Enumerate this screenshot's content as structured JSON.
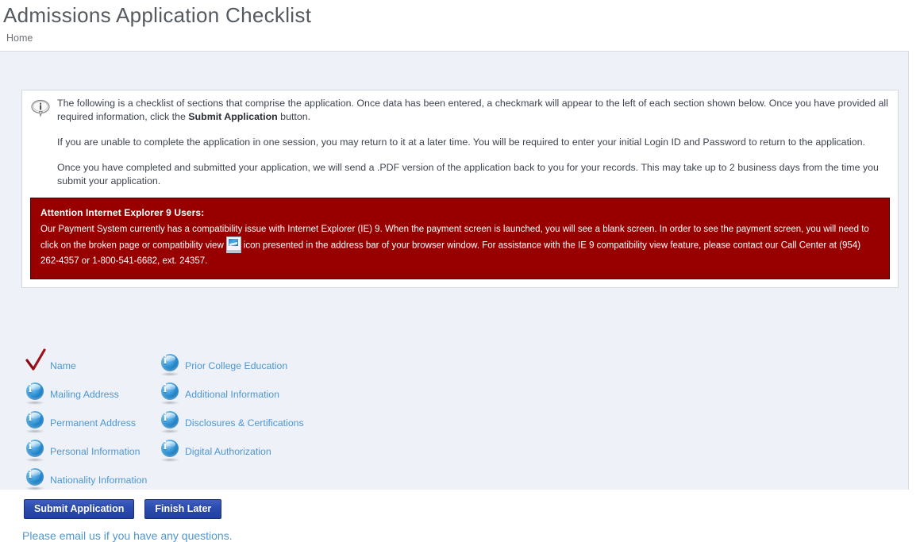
{
  "header": {
    "title": "Admissions Application Checklist",
    "breadcrumb": "Home"
  },
  "info_panel": {
    "icon": "info-bubble-icon",
    "paragraphs": [
      {
        "pre": "The following is a checklist of sections that comprise the application. Once data has been entered, a checkmark will appear to the left of each section shown below. Once you have provided all required information, click the ",
        "bold": "Submit Application",
        "post": " button."
      },
      {
        "pre": "If you are unable to complete the application in one session, you may return to it at a later time. You will be required to enter your initial Login ID and Password to return to the application.",
        "bold": "",
        "post": ""
      },
      {
        "pre": "Once you have completed and submitted your application, we will send a .PDF version of the application back to you for your records. This may take up to 2 business days from the time you submit your application.",
        "bold": "",
        "post": ""
      }
    ]
  },
  "ie_alert": {
    "title": "Attention Internet Explorer 9 Users:",
    "body_part1": "Our Payment System currently has a compatibility issue with Internet Explorer (IE) 9. When the payment screen is launched, you will see a blank screen. In order to see the payment screen, you will need to click on the broken page or compatibility view",
    "icon": "compatibility-view-icon",
    "body_part2": "icon presented in the address bar of your browser window. For assistance with the IE 9 compatibility view feature, please contact our Call Center at (954) 262-4357 or 1-800-541-6682, ext. 24357.",
    "background_color": "#980000",
    "text_color": "#ffffff"
  },
  "checklist": {
    "left_column": [
      {
        "label": "Name",
        "status": "complete",
        "icon": "red-checkmark-icon"
      },
      {
        "label": "Mailing Address",
        "status": "incomplete",
        "icon": "blue-info-ball-icon"
      },
      {
        "label": "Permanent Address",
        "status": "incomplete",
        "icon": "blue-info-ball-icon"
      },
      {
        "label": "Personal Information",
        "status": "incomplete",
        "icon": "blue-info-ball-icon"
      },
      {
        "label": "Nationality Information",
        "status": "incomplete",
        "icon": "blue-info-ball-icon"
      }
    ],
    "right_column": [
      {
        "label": "Prior College Education",
        "status": "incomplete",
        "icon": "blue-info-ball-icon"
      },
      {
        "label": "Additional Information",
        "status": "incomplete",
        "icon": "blue-info-ball-icon"
      },
      {
        "label": "Disclosures & Certifications",
        "status": "incomplete",
        "icon": "blue-info-ball-icon"
      },
      {
        "label": "Digital Authorization",
        "status": "incomplete",
        "icon": "blue-info-ball-icon"
      }
    ],
    "link_color": "#4d97d4"
  },
  "buttons": {
    "submit_label": "Submit Application",
    "finish_later_label": "Finish Later",
    "accent_color": "#2c4db0"
  },
  "footer": {
    "email_link": "Please email us if you have any questions."
  }
}
